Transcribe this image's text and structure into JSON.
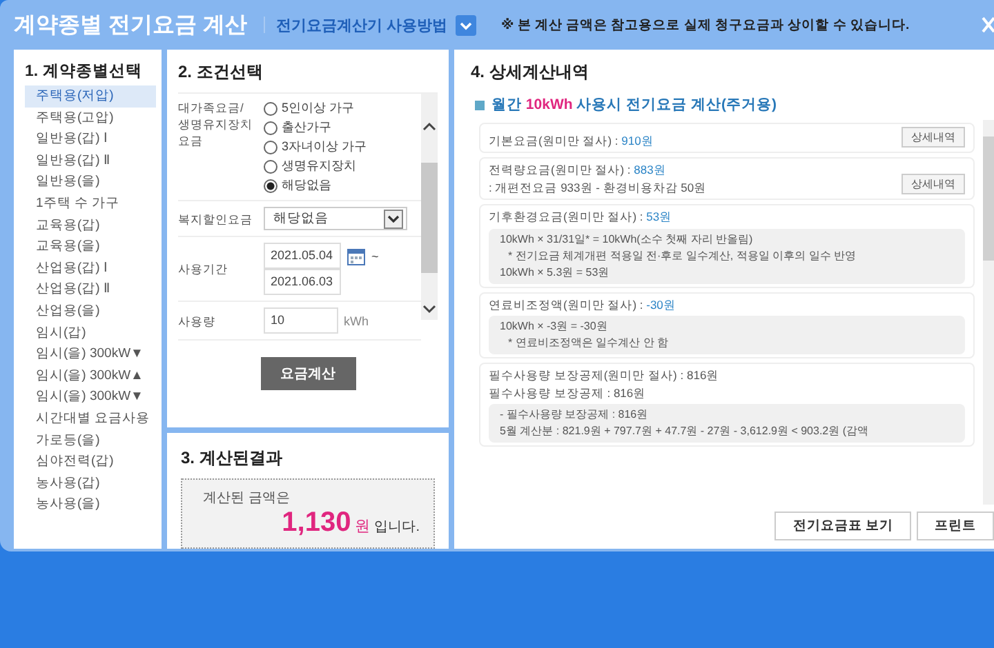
{
  "header": {
    "title": "계약종별 전기요금 계산",
    "help_link": "전기요금계산기 사용방법",
    "notice": "※ 본 계산 금액은 참고용으로 실제 청구요금과 상이할 수 있습니다."
  },
  "contract_types": {
    "title": "1. 계약종별선택",
    "items": [
      {
        "label": "주택용(저압)",
        "selected": true
      },
      {
        "label": "주택용(고압)",
        "selected": false
      },
      {
        "label": "일반용(갑) Ⅰ",
        "selected": false
      },
      {
        "label": "일반용(갑) Ⅱ",
        "selected": false
      },
      {
        "label": "일반용(을)",
        "selected": false
      },
      {
        "label": "1주택 수 가구",
        "selected": false
      },
      {
        "label": "교육용(갑)",
        "selected": false
      },
      {
        "label": "교육용(을)",
        "selected": false
      },
      {
        "label": "산업용(갑) Ⅰ",
        "selected": false
      },
      {
        "label": "산업용(갑) Ⅱ",
        "selected": false
      },
      {
        "label": "산업용(을)",
        "selected": false
      },
      {
        "label": "임시(갑)",
        "selected": false
      },
      {
        "label": "임시(을) 300kW▼",
        "selected": false
      },
      {
        "label": "임시(을) 300kW▲",
        "selected": false
      },
      {
        "label": "임시(을) 300kW▼",
        "selected": false
      },
      {
        "label": "시간대별 요금사용",
        "selected": false
      },
      {
        "label": "가로등(을)",
        "selected": false
      },
      {
        "label": "심야전력(갑)",
        "selected": false
      },
      {
        "label": "농사용(갑)",
        "selected": false
      },
      {
        "label": "농사용(을)",
        "selected": false
      }
    ]
  },
  "conditions": {
    "title": "2. 조건선택",
    "family": {
      "label": "대가족요금/ 생명유지장치 요금",
      "options": [
        {
          "label": "5인이상 가구",
          "selected": false
        },
        {
          "label": "출산가구",
          "selected": false
        },
        {
          "label": "3자녀이상 가구",
          "selected": false
        },
        {
          "label": "생명유지장치",
          "selected": false
        },
        {
          "label": "해당없음",
          "selected": true
        }
      ]
    },
    "welfare": {
      "label": "복지할인요금",
      "value": "해당없음"
    },
    "period": {
      "label": "사용기간",
      "start": "2021.05.04",
      "end": "2021.06.03",
      "separator": "~"
    },
    "usage": {
      "label": "사용량",
      "value": "10",
      "unit": "kWh"
    },
    "button": "요금계산"
  },
  "result": {
    "title": "3. 계산된결과",
    "prefix": "계산된 금액은",
    "amount": "1,130",
    "unit": "원",
    "suffix": "입니다."
  },
  "details": {
    "title": "4. 상세계산내역",
    "heading_before": "월간",
    "heading_highlight": "10kWh",
    "heading_after": "사용시 전기요금 계산(주거용)",
    "cards": [
      {
        "label": "기본요금(원미만 절사) : ",
        "value": "910원",
        "highlight": true,
        "button": "상세내역"
      },
      {
        "label": "전력량요금(원미만 절사) : ",
        "value": "883원",
        "highlight": true,
        "lines": [
          ": 개편전요금 933원  -  환경비용차감 50원"
        ],
        "button": "상세내역"
      },
      {
        "label": "기후환경요금(원미만 절사) : ",
        "value": "53원",
        "highlight": true,
        "box": [
          {
            "text": "10kWh × 31/31일* = 10kWh(소수 첫째 자리 반올림)",
            "note": false
          },
          {
            "text": "* 전기요금 체계개편 적용일 전·후로 일수계산, 적용일 이후의 일수 반영",
            "note": true
          },
          {
            "text": "10kWh × 5.3원 = 53원",
            "note": false
          }
        ]
      },
      {
        "label": "연료비조정액(원미만 절사) : ",
        "value": "-30원",
        "highlight": true,
        "box": [
          {
            "text": "10kWh × -3원 = -30원",
            "note": false
          },
          {
            "text": "* 연료비조정액은 일수계산 안 함",
            "note": true
          }
        ]
      },
      {
        "label": "필수사용량 보장공제(원미만 절사) : ",
        "value": "816원",
        "highlight": false,
        "lines": [
          "필수사용량 보장공제 : 816원"
        ],
        "box": [
          {
            "text": "- 필수사용량 보장공제 : 816원",
            "note": false
          },
          {
            "text": "5월 계산분 : 821.9원 + 797.7원 + 47.7원  -  27원  -  3,612.9원  < 903.2원 (감액",
            "note": false
          }
        ]
      }
    ],
    "buttons": [
      "전기요금표 보기",
      "프린트"
    ]
  }
}
